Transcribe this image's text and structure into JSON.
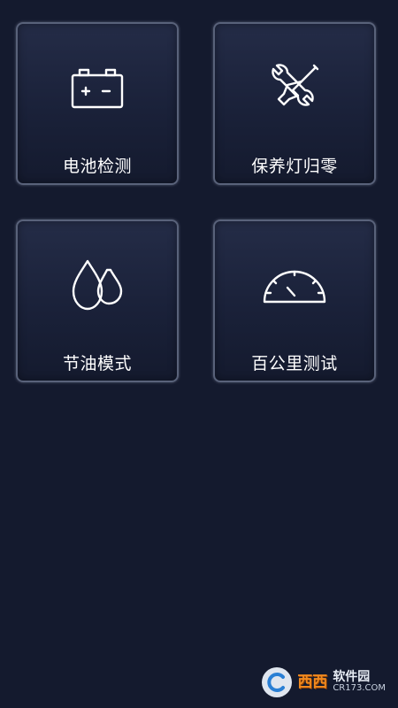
{
  "tiles": [
    {
      "label": "电池检测",
      "icon": "battery-icon"
    },
    {
      "label": "保养灯归零",
      "icon": "wrench-screwdriver-icon"
    },
    {
      "label": "节油模式",
      "icon": "water-drops-icon"
    },
    {
      "label": "百公里测试",
      "icon": "speedometer-icon"
    }
  ],
  "watermark": {
    "brand": "西西",
    "name": "软件园",
    "url": "CR173.COM"
  },
  "colors": {
    "background": "#141a2e",
    "tile_border": "#59627a",
    "text": "#ffffff",
    "watermark_accent": "#f28a1e"
  }
}
